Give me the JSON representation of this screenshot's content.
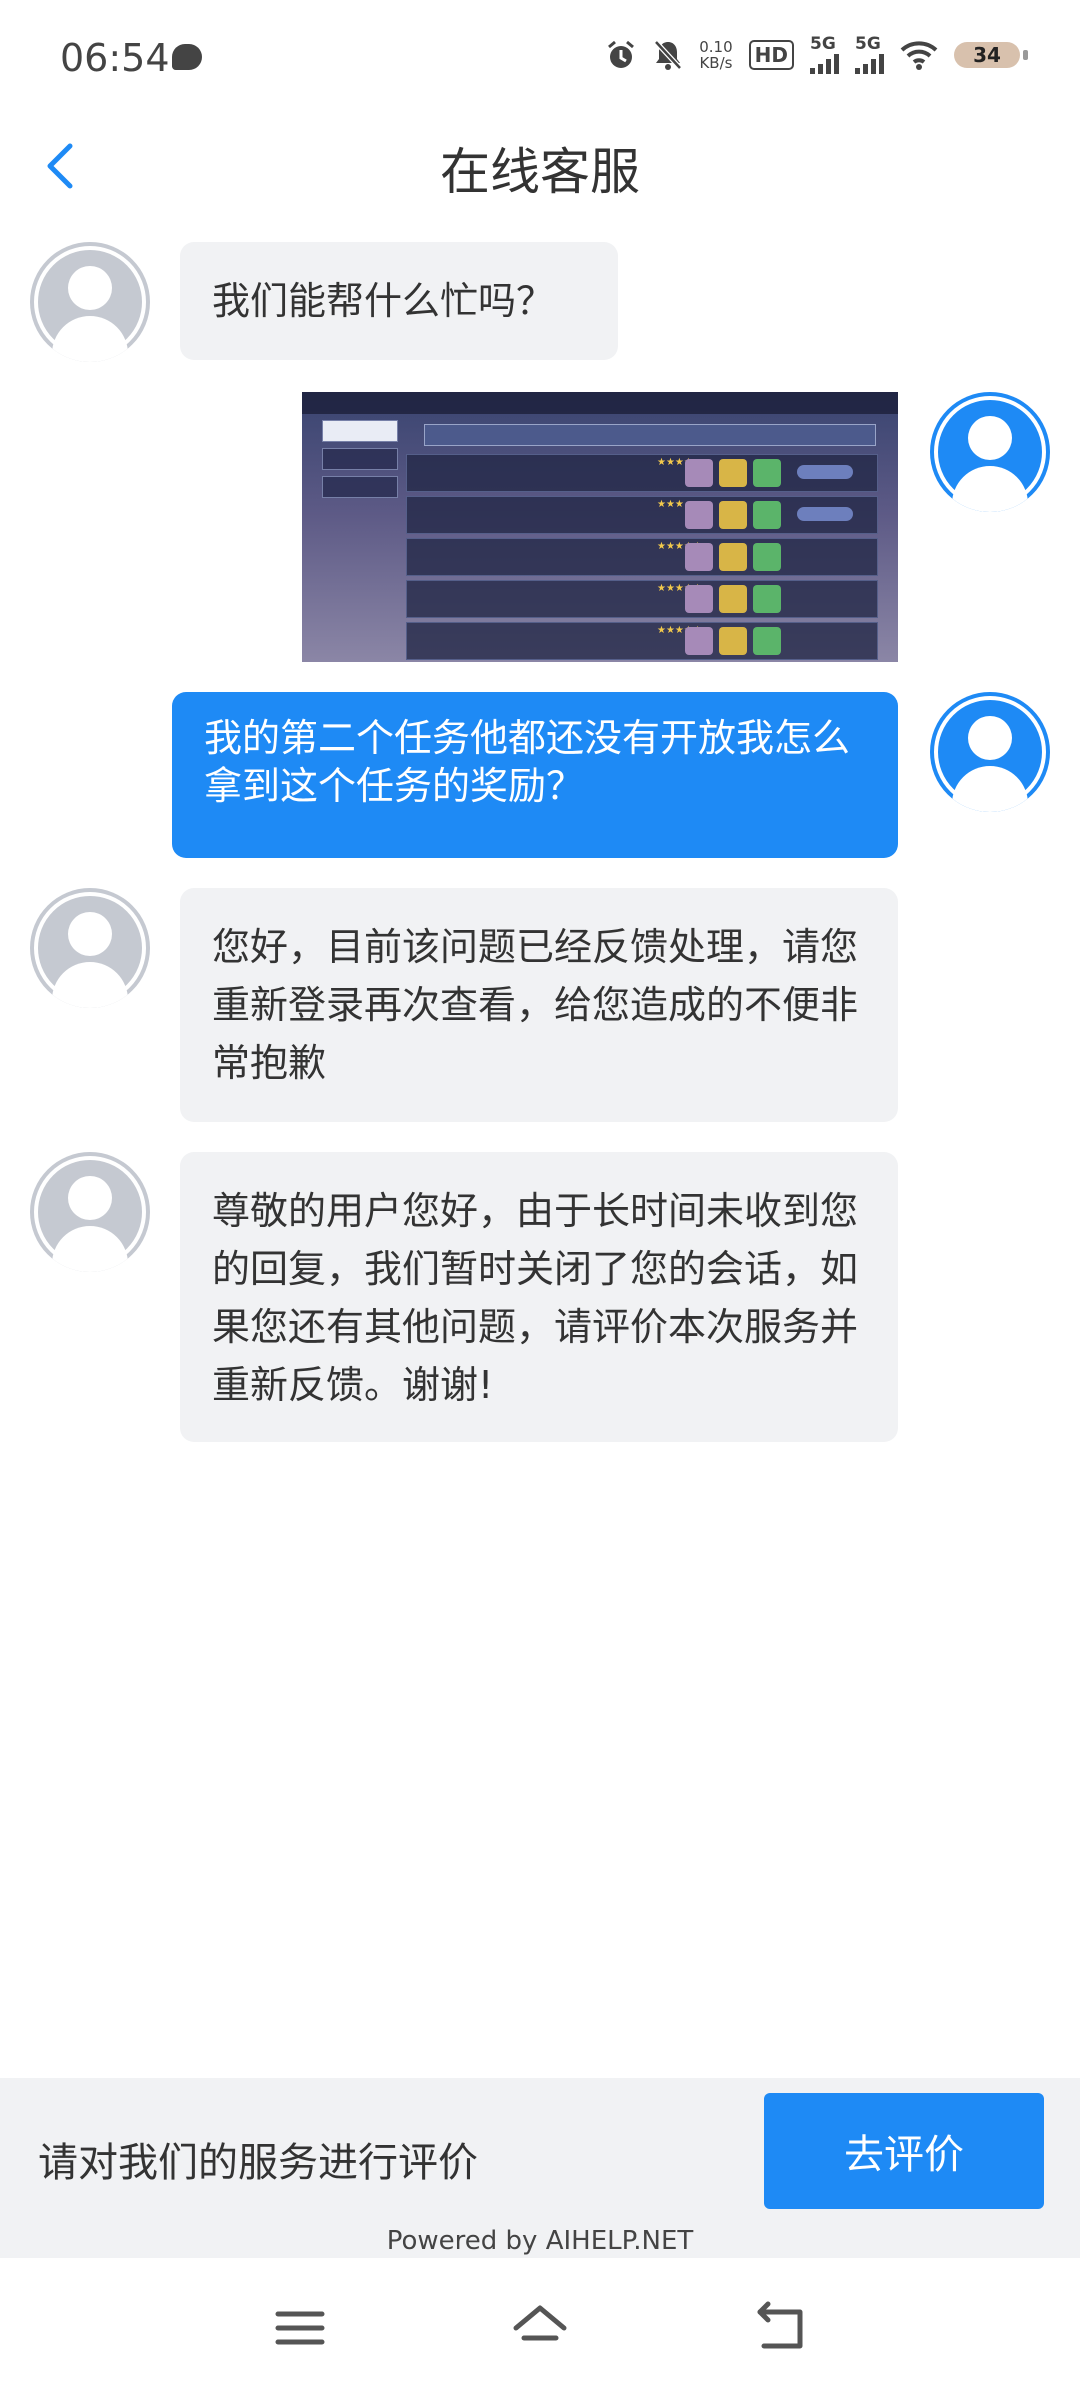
{
  "status_bar": {
    "time": "06:54",
    "speed_value": "0.10",
    "speed_unit": "KB/s",
    "hd_label": "HD",
    "net1": "5G",
    "net2": "5G",
    "battery": "34"
  },
  "header": {
    "title": "在线客服"
  },
  "messages": [
    {
      "sender": "agent",
      "text": "我们能帮什么忙吗？"
    },
    {
      "sender": "user",
      "type": "image"
    },
    {
      "sender": "user",
      "text": "我的第二个任务他都还没有开放我怎么拿到这个任务的奖励？"
    },
    {
      "sender": "agent",
      "text": "您好，目前该问题已经反馈处理，请您重新登录再次查看，给您造成的不便非常抱歉"
    },
    {
      "sender": "agent",
      "text": "尊敬的用户您好，由于长时间未收到您的回复，我们暂时关闭了您的会话，如果您还有其他问题，请评价本次服务并重新反馈。谢谢!"
    }
  ],
  "rating": {
    "prompt": "请对我们的服务进行评价",
    "button": "去评价",
    "powered_by": "Powered by AIHELP.NET"
  },
  "icons": {
    "back": "chevron-left-icon",
    "avatar": "person-icon",
    "nav_menu": "menu-icon",
    "nav_home": "home-icon",
    "nav_back": "back-icon"
  },
  "colors": {
    "accent": "#1e8af5",
    "agent_bubble": "#f1f2f4",
    "agent_avatar": "#c5c9d1"
  }
}
